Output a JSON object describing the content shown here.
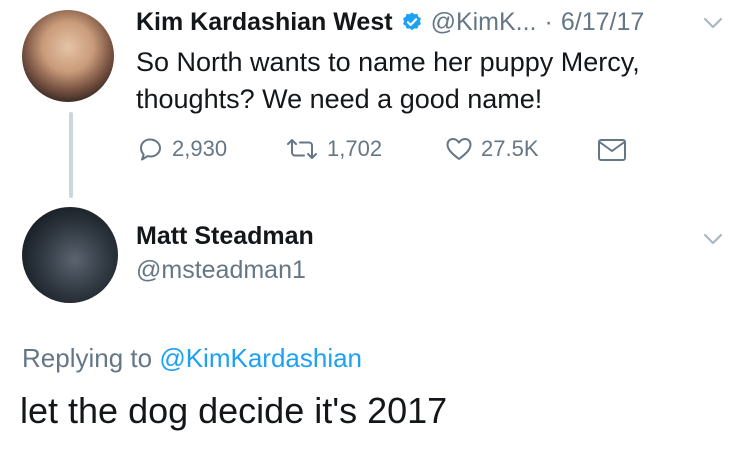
{
  "original_tweet": {
    "author_name": "Kim Kardashian West",
    "handle": "@KimK...",
    "separator": "·",
    "date": "6/17/17",
    "text_line1": "So North wants to name her puppy Mercy,",
    "text_line2": "thoughts? We need a good name!",
    "reply_count": "2,930",
    "retweet_count": "1,702",
    "like_count": "27.5K",
    "verified": true,
    "avatar": "kim-avatar"
  },
  "reply_tweet": {
    "author_name": "Matt Steadman",
    "handle": "@msteadman1",
    "replying_to_label": "Replying to",
    "replying_to_handle": "@KimKardashian",
    "text": "let the dog decide it's 2017",
    "avatar": "matt-avatar"
  },
  "icons": {
    "reply": "reply-icon",
    "retweet": "retweet-icon",
    "like": "heart-icon",
    "message": "envelope-icon",
    "verified": "verified-badge-icon",
    "menu": "chevron-down-icon"
  },
  "colors": {
    "text": "#14171a",
    "secondary": "#657786",
    "link": "#1da1f2",
    "verified": "#1da1f2",
    "thread_line": "#ccd6dd"
  }
}
